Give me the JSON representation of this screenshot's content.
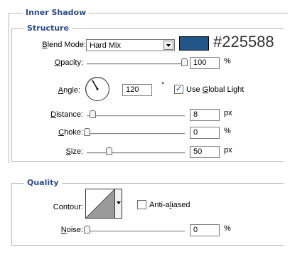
{
  "inner_shadow": {
    "title": "Inner Shadow"
  },
  "structure": {
    "title": "Structure",
    "blend_mode": {
      "label": "Blend Mode:",
      "value": "Hard Mix"
    },
    "color": {
      "hex": "#225588",
      "swatch": "#225588"
    },
    "opacity": {
      "label": "Opacity:",
      "value": "100",
      "unit": "%",
      "level": 1.0
    },
    "angle": {
      "label": "Angle:",
      "value": "120",
      "unit": "°",
      "global_light_label": "Use Global Light",
      "global_light_checked": true,
      "check_mark": "✓"
    },
    "distance": {
      "label": "Distance:",
      "value": "8",
      "unit": "px",
      "level": 0.03
    },
    "choke": {
      "label": "Choke:",
      "value": "0",
      "unit": "%",
      "level": 0.0
    },
    "size": {
      "label": "Size:",
      "value": "50",
      "unit": "px",
      "level": 0.2
    }
  },
  "quality": {
    "title": "Quality",
    "contour": {
      "label": "Contour:"
    },
    "anti_aliased": {
      "label": "Anti-aliased",
      "checked": false
    },
    "noise": {
      "label": "Noise:",
      "value": "0",
      "unit": "%",
      "level": 0.0
    }
  }
}
